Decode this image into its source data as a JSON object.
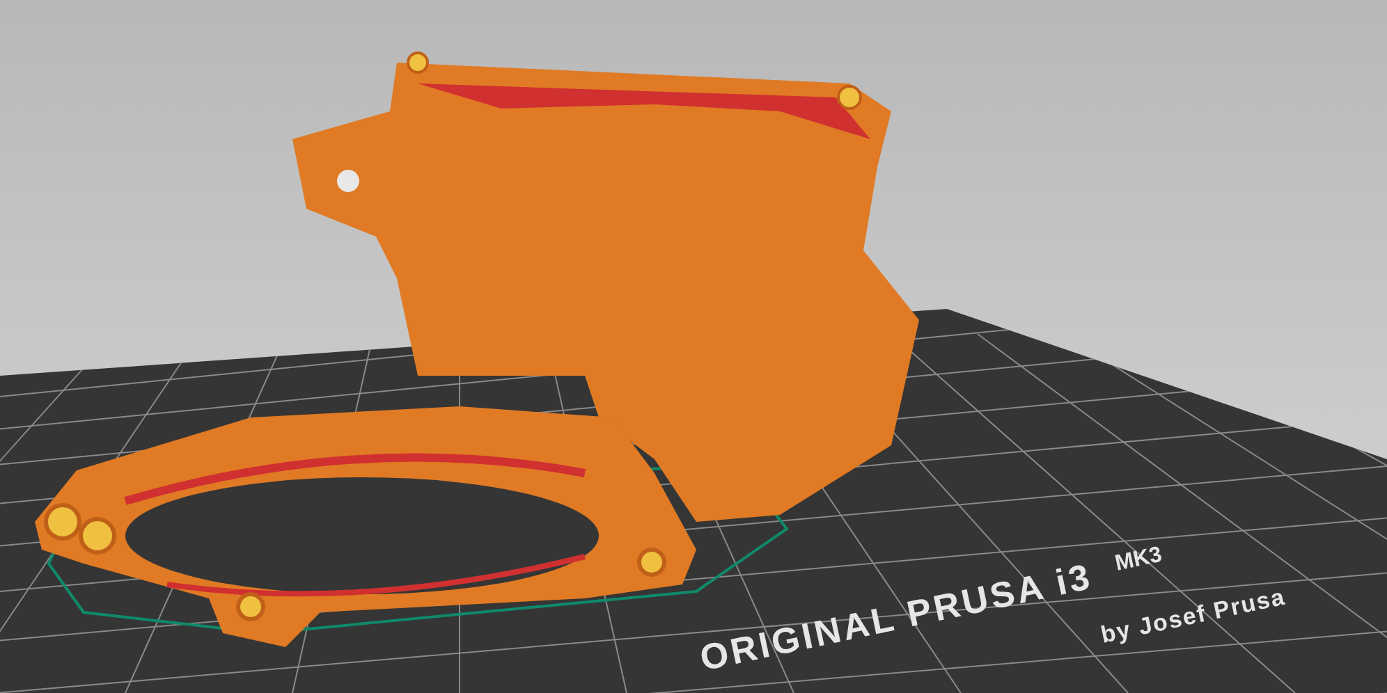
{
  "bed": {
    "label": "ORIGINAL PRUSA i3",
    "model": "MK3",
    "credit": "by Josef Prusa"
  }
}
